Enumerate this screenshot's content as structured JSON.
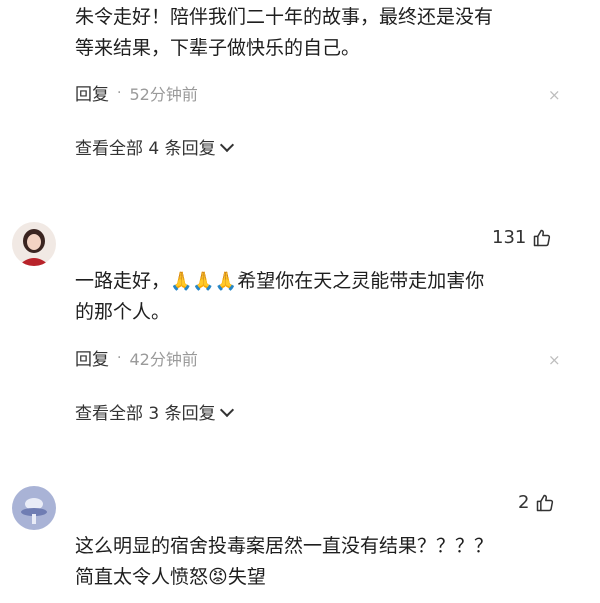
{
  "comments": [
    {
      "text_line1": "朱令走好！陪伴我们二十年的故事，最终还是没有",
      "text_line2": "等来结果，下辈子做快乐的自己。",
      "reply_label": "回复",
      "separator": "·",
      "time": "52分钟前",
      "close_glyph": "×",
      "view_all": "查看全部 4 条回复"
    },
    {
      "likes": "131",
      "text_line1_a": "一路走好，",
      "emojis": "🙏🙏🙏",
      "text_line1_b": "希望你在天之灵能带走加害你",
      "text_line2": "的那个人。",
      "reply_label": "回复",
      "separator": "·",
      "time": "42分钟前",
      "close_glyph": "×",
      "view_all": "查看全部 3 条回复"
    },
    {
      "likes": "2",
      "text_line1": "这么明显的宿舍投毒案居然一直没有结果？？？？",
      "text_line2_a": "简直太令人愤怒",
      "angry_emoji": "😡",
      "text_line2_b": "失望"
    }
  ],
  "colors": {
    "text": "#1e1e1e",
    "muted": "#9a9a9a",
    "close": "#bdbdbd"
  }
}
